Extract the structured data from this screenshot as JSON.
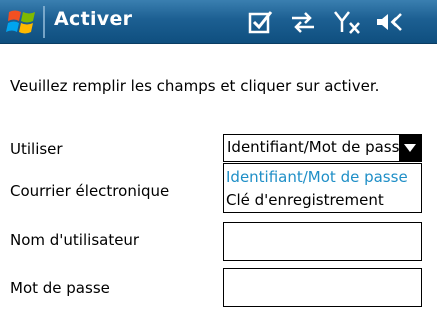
{
  "titlebar": {
    "title": "Activer",
    "icons": [
      "windows-start-icon",
      "edit-check-icon",
      "connectivity-icon",
      "signal-off-icon",
      "volume-icon"
    ]
  },
  "form": {
    "instruction": "Veuillez remplir les champs et cliquer sur activer.",
    "use_label": "Utiliser",
    "use_value": "Identifiant/Mot de passe",
    "options": [
      "Identifiant/Mot de passe",
      "Clé d'enregistrement"
    ],
    "email_label": "Courrier électronique",
    "username_label": "Nom d'utilisateur",
    "password_label": "Mot de passe",
    "email_value": "",
    "username_value": "",
    "password_value": ""
  },
  "colors": {
    "titlebar": "#1c5f92",
    "selected_option": "#1f8fc7"
  }
}
